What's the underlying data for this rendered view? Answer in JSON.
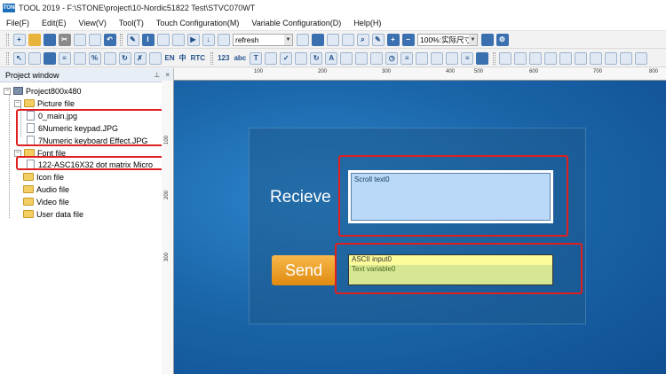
{
  "window": {
    "title": "TOOL 2019 - F:\\STONE\\project\\10-Nordic51822 Test\\STVC070WT",
    "logo_text": "STONE"
  },
  "menu": [
    "File(F)",
    "Edit(E)",
    "View(V)",
    "Tool(T)",
    "Touch Configuration(M)",
    "Variable Configuration(D)",
    "Help(H)"
  ],
  "toolbar": {
    "refresh_label": "refresh",
    "zoom_label": "100%:实际尺寸",
    "en_label": "EN",
    "zh_label": "中",
    "rtc_label": "RTC",
    "num_label": "123",
    "abc_label": "abc"
  },
  "project_window": {
    "title": "Project window",
    "root": "Project800x480",
    "picture_folder": "Picture file",
    "pictures": [
      "0_main.jpg",
      "6Numeric keypad.JPG",
      "7Numeric keyboard Effect.JPG"
    ],
    "font_folder": "Font file",
    "fonts": [
      "122-ASC16X32 dot matrix Micro"
    ],
    "other_folders": [
      "Icon file",
      "Audio file",
      "Video file",
      "User data file"
    ]
  },
  "ruler": {
    "top": [
      "100",
      "200",
      "300",
      "400",
      "500",
      "600",
      "700",
      "800"
    ],
    "left": [
      "100",
      "200",
      "300"
    ]
  },
  "canvas": {
    "recieve_label": "Recieve",
    "scroll_text": "Scroll text0",
    "send_label": "Send",
    "ascii_input": "ASCII input0",
    "text_variable": "Text variable0"
  },
  "colors": {
    "canvas_bg": "#1e6bb0",
    "highlight_box": "#e02020",
    "send_button": "#f0a030"
  }
}
